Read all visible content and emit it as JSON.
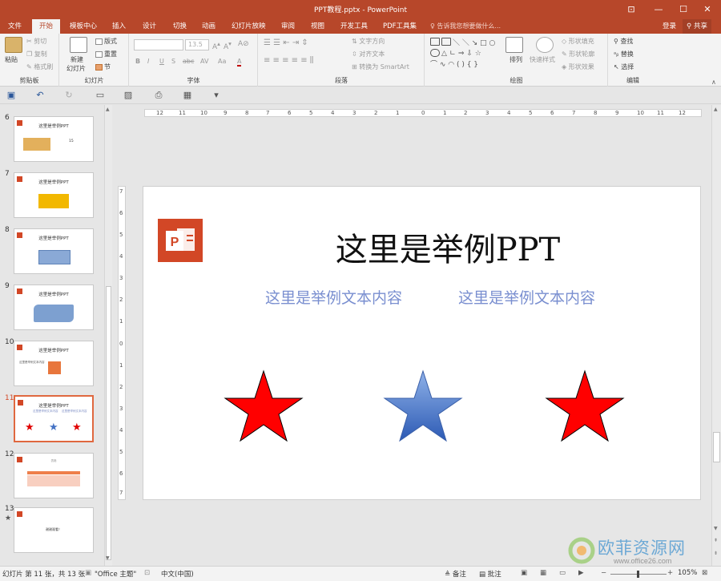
{
  "window": {
    "title": "PPT教程.pptx - PowerPoint",
    "controls": {
      "ribbon_display": "⊡",
      "minimize": "—",
      "maximize": "☐",
      "close": "✕"
    }
  },
  "tabs": [
    {
      "label": "文件"
    },
    {
      "label": "开始",
      "active": true
    },
    {
      "label": "模板中心"
    },
    {
      "label": "插入"
    },
    {
      "label": "设计"
    },
    {
      "label": "切换"
    },
    {
      "label": "动画"
    },
    {
      "label": "幻灯片放映"
    },
    {
      "label": "审阅"
    },
    {
      "label": "视图"
    },
    {
      "label": "开发工具"
    },
    {
      "label": "PDF工具集"
    }
  ],
  "tell_me": "告诉我您想要做什么...",
  "account": {
    "signin": "登录",
    "share": "共享"
  },
  "ribbon": {
    "clipboard": {
      "paste": "粘贴",
      "cut": "剪切",
      "copy": "复制",
      "format_painter": "格式刷",
      "label": "剪贴板"
    },
    "slides": {
      "new_slide": "新建",
      "new_slide_2": "幻灯片",
      "layout": "版式",
      "reset": "重置",
      "section": "节",
      "label": "幻灯片"
    },
    "font": {
      "size": "13.5",
      "bold": "B",
      "italic": "I",
      "underline": "U",
      "shadow": "S",
      "strike": "abc",
      "spacing": "AV",
      "case": "Aa",
      "color": "A",
      "label": "字体"
    },
    "paragraph": {
      "text_direction": "文字方向",
      "align_text": "对齐文本",
      "convert_smartart": "转换为 SmartArt",
      "label": "段落"
    },
    "drawing": {
      "arrange": "排列",
      "quick_styles": "快速样式",
      "shape_fill": "形状填充",
      "shape_outline": "形状轮廓",
      "shape_effects": "形状效果",
      "label": "绘图"
    },
    "editing": {
      "find": "查找",
      "replace": "替换",
      "select": "选择",
      "label": "编辑"
    }
  },
  "ruler": {
    "h_labels": [
      "12",
      "11",
      "10",
      "9",
      "8",
      "7",
      "6",
      "5",
      "4",
      "3",
      "2",
      "1",
      "0",
      "1",
      "2",
      "3",
      "4",
      "5",
      "6",
      "7",
      "8",
      "9",
      "10",
      "11",
      "12"
    ],
    "v_labels": [
      "7",
      "6",
      "5",
      "4",
      "3",
      "2",
      "1",
      "0",
      "1",
      "2",
      "3",
      "4",
      "5",
      "6",
      "7"
    ]
  },
  "thumbnails": [
    {
      "num": "6",
      "title": "这里是举例PPT",
      "extra": "15"
    },
    {
      "num": "7",
      "title": "这里是举例PPT"
    },
    {
      "num": "8",
      "title": "这里是举例PPT"
    },
    {
      "num": "9",
      "title": "这里是举例PPT"
    },
    {
      "num": "10",
      "title": "这里是举例PPT",
      "extra": "这里是举例文本内容"
    },
    {
      "num": "11",
      "title": "这里是举例PPT",
      "sub_left": "这里是举例文本内容",
      "sub_right": "这里是举例文本内容",
      "selected": true
    },
    {
      "num": "12",
      "title": "表格"
    },
    {
      "num": "13",
      "title": "谢谢观看！",
      "star": "★"
    }
  ],
  "slide": {
    "title": "这里是举例PPT",
    "text_left": "这里是举例文本内容",
    "text_right": "这里是举例文本内容",
    "star_colors": {
      "left": "#ff0000",
      "middle": "#4472c4",
      "right": "#ff0000"
    }
  },
  "status": {
    "slide_info": "幻灯片 第 11 张，共 13 张",
    "theme": "\"Office 主题\"",
    "language": "中文(中国)",
    "notes": "备注",
    "comments": "批注",
    "zoom": "105%"
  },
  "watermark": {
    "text": "欧菲资源网",
    "url": "www.office26.com"
  },
  "colors": {
    "brand": "#b7472a",
    "accent": "#d24726",
    "selected": "#e0683f"
  }
}
